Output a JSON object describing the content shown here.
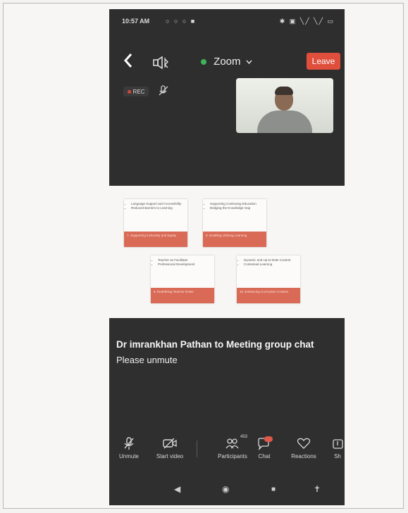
{
  "status_bar": {
    "time": "10:57 AM",
    "left_icons": "○ ○ ○ ■",
    "right_icons": "✱ ▣ ╲╱ ╲╱ ▭"
  },
  "meeting": {
    "title": "Zoom",
    "leave_label": "Leave",
    "rec_label": "REC",
    "colors": {
      "leave": "#e04e3c",
      "connected_dot": "#3db35b",
      "background": "#2e2e2e"
    }
  },
  "slides": [
    {
      "bullets": [
        "Language Support and Accessibility",
        "Reduced Barriers to Learning"
      ],
      "title": "7. Supporting Inclusivity and Equity"
    },
    {
      "bullets": [
        "Supporting Continuing Education",
        "Bridging the Knowledge Gap"
      ],
      "title": "8. Enabling Lifelong Learning"
    },
    {
      "bullets": [
        "Teacher as Facilitator",
        "Professional Development"
      ],
      "title": "9. Redefining Teacher Roles"
    },
    {
      "bullets": [
        "Dynamic and Up-to-Date Content",
        "Contextual Learning"
      ],
      "title": "10. Enhancing Curriculum Content"
    }
  ],
  "chat": {
    "sender_line": "Dr imrankhan Pathan to Meeting group chat",
    "message": "Please unmute"
  },
  "toolbar": {
    "unmute": "Unmute",
    "start_video": "Start video",
    "participants": "Participants",
    "participants_count": "453",
    "chat": "Chat",
    "reactions": "Reactions",
    "share": "Sh"
  },
  "icons": {
    "back": "chevron-left-icon",
    "audio": "speaker-bluetooth-icon",
    "mic_off": "mic-off-icon",
    "video_off": "video-off-icon",
    "participants": "people-icon",
    "chat": "chat-bubble-icon",
    "reactions": "heart-icon",
    "share": "share-icon",
    "nav_back": "triangle-back-icon",
    "nav_home": "circle-home-icon",
    "nav_recents": "square-recents-icon",
    "nav_accessibility": "accessibility-icon"
  },
  "navbar": {
    "back_glyph": "◀",
    "home_glyph": "◉",
    "recents_glyph": "■",
    "accessibility_glyph": "✝"
  }
}
